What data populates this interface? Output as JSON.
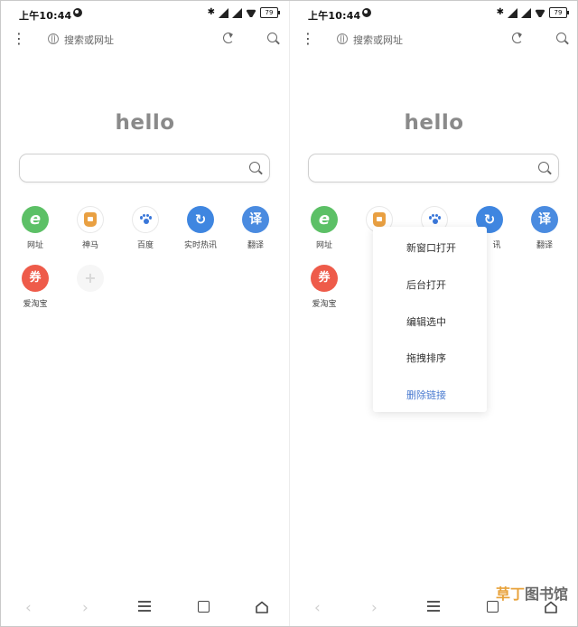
{
  "status_bar": {
    "time": "上午10:44",
    "battery": "79"
  },
  "address_bar": {
    "placeholder": "搜索或网址"
  },
  "home": {
    "hello": "hello"
  },
  "shortcuts": [
    {
      "label": "网址",
      "glyph": "e",
      "color": "#5cc066"
    },
    {
      "label": "神马",
      "icon": "shenma-icon",
      "color": "#e9a042"
    },
    {
      "label": "百度",
      "icon": "baidu-paw-icon",
      "color": "#3a77d9"
    },
    {
      "label": "实时热讯",
      "glyph": "↻",
      "color": "#3f86e0"
    },
    {
      "label": "翻译",
      "glyph": "译",
      "color": "#4a8be0"
    },
    {
      "label": "爱淘宝",
      "glyph": "券",
      "color": "#ee5b4a"
    },
    {
      "label": "",
      "glyph": "+",
      "color": "#f6f6f6"
    }
  ],
  "context_menu": {
    "items": [
      "新窗口打开",
      "后台打开",
      "编辑选中",
      "拖拽排序",
      "删除链接"
    ]
  },
  "partial_label": "讯",
  "watermark": {
    "part1": "草丁",
    "part2": "图书馆"
  }
}
